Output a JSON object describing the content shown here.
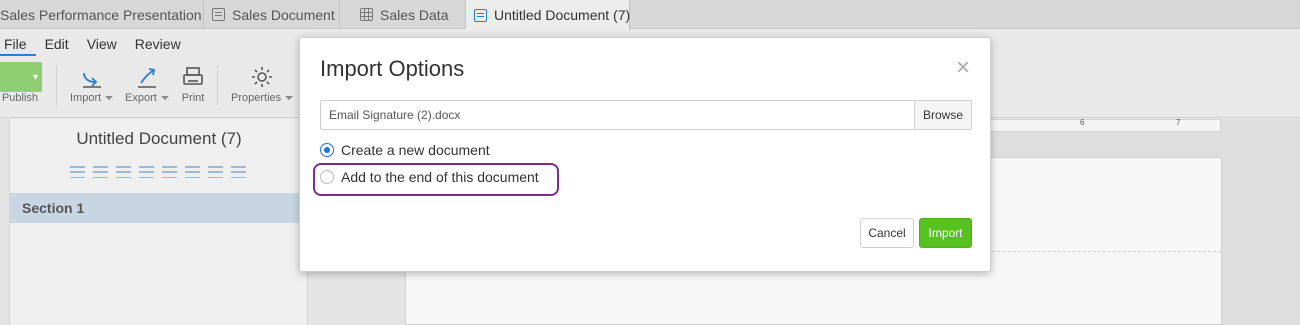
{
  "tabs": [
    {
      "label": "Sales Performance Presentation",
      "icon": "presentation-icon"
    },
    {
      "label": "Sales Document",
      "icon": "document-icon"
    },
    {
      "label": "Sales Data",
      "icon": "spreadsheet-icon"
    },
    {
      "label": "Untitled Document (7)",
      "icon": "document-icon",
      "active": true
    }
  ],
  "menu": [
    "File",
    "Edit",
    "View",
    "Review"
  ],
  "ribbon": {
    "publish": "Publish",
    "import": "Import",
    "export": "Export",
    "print": "Print",
    "properties": "Properties"
  },
  "left_pane": {
    "title": "Untitled Document (7)",
    "section": "Section 1"
  },
  "ruler": {
    "mark1": "6",
    "mark2": "7"
  },
  "dialog": {
    "title": "Import Options",
    "close": "×",
    "file_value": "Email Signature (2).docx",
    "browse": "Browse",
    "option_new": "Create a new document",
    "option_append": "Add to the end of this document",
    "cancel": "Cancel",
    "import": "Import"
  },
  "colors": {
    "accent": "#1a73e8",
    "import_button": "#57c21f",
    "highlight": "#7b2d8b",
    "publish": "#8fce72"
  }
}
